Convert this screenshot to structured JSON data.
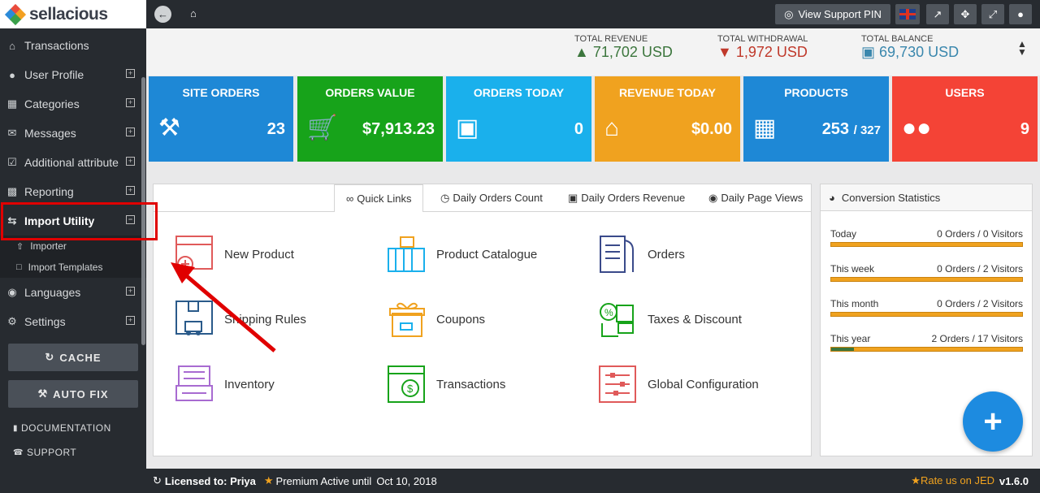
{
  "brand": {
    "name": "sellacious"
  },
  "sidebar": {
    "items": [
      {
        "label": "Transactions",
        "icon": "bank-icon"
      },
      {
        "label": "User Profile",
        "icon": "user-icon"
      },
      {
        "label": "Categories",
        "icon": "sitemap-icon"
      },
      {
        "label": "Messages",
        "icon": "envelope-icon"
      },
      {
        "label": "Additional attribute",
        "icon": "check-square-icon"
      },
      {
        "label": "Reporting",
        "icon": "bar-chart-icon"
      },
      {
        "label": "Import Utility",
        "icon": "exchange-icon"
      }
    ],
    "subitems": [
      {
        "label": "Importer"
      },
      {
        "label": "Import Templates"
      }
    ],
    "items2": [
      {
        "label": "Languages"
      },
      {
        "label": "Settings"
      }
    ],
    "cache_label": "CACHE",
    "autofix_label": "AUTO FIX",
    "documentation_label": "DOCUMENTATION",
    "support_label": "SUPPORT"
  },
  "topbar": {
    "support_pin_label": "View Support PIN"
  },
  "stats": {
    "revenue": {
      "label": "TOTAL REVENUE",
      "value": "71,702 USD",
      "color": "#3c763d"
    },
    "withdrawal": {
      "label": "TOTAL WITHDRAWAL",
      "value": "1,972 USD",
      "color": "#c0392b"
    },
    "balance": {
      "label": "TOTAL BALANCE",
      "value": "69,730 USD",
      "color": "#3a87ad"
    }
  },
  "tiles": [
    {
      "title": "SITE ORDERS",
      "value": "23",
      "color": "#1e88d6"
    },
    {
      "title": "ORDERS VALUE",
      "value": "$7,913.23",
      "color": "#17a31a"
    },
    {
      "title": "ORDERS TODAY",
      "value": "0",
      "color": "#1ab0ec"
    },
    {
      "title": "REVENUE TODAY",
      "value": "$0.00",
      "color": "#f0a21f"
    },
    {
      "title": "PRODUCTS",
      "value": "253",
      "value2": "/ 327",
      "color": "#1e88d6"
    },
    {
      "title": "USERS",
      "value": "9",
      "color": "#f44336"
    }
  ],
  "tabs": [
    {
      "label": "Quick Links"
    },
    {
      "label": "Daily Orders Count"
    },
    {
      "label": "Daily Orders Revenue"
    },
    {
      "label": "Daily Page Views"
    }
  ],
  "quicklinks": [
    {
      "label": "New Product"
    },
    {
      "label": "Product Catalogue"
    },
    {
      "label": "Orders"
    },
    {
      "label": "Shipping Rules"
    },
    {
      "label": "Coupons"
    },
    {
      "label": "Taxes & Discount"
    },
    {
      "label": "Inventory"
    },
    {
      "label": "Transactions"
    },
    {
      "label": "Global Configuration"
    }
  ],
  "conversion": {
    "title": "Conversion Statistics",
    "rows": [
      {
        "period": "Today",
        "value": "0 Orders / 0 Visitors",
        "ratio": 0
      },
      {
        "period": "This week",
        "value": "0 Orders / 2 Visitors",
        "ratio": 0
      },
      {
        "period": "This month",
        "value": "0 Orders / 2 Visitors",
        "ratio": 0
      },
      {
        "period": "This year",
        "value": "2 Orders / 17 Visitors",
        "ratio": 0.118
      }
    ]
  },
  "footer": {
    "licensed": "Licensed to: Priya",
    "premium": "Premium Active until",
    "date": "Oct 10, 2018",
    "rate": "Rate us on JED",
    "version": "v1.6.0"
  }
}
